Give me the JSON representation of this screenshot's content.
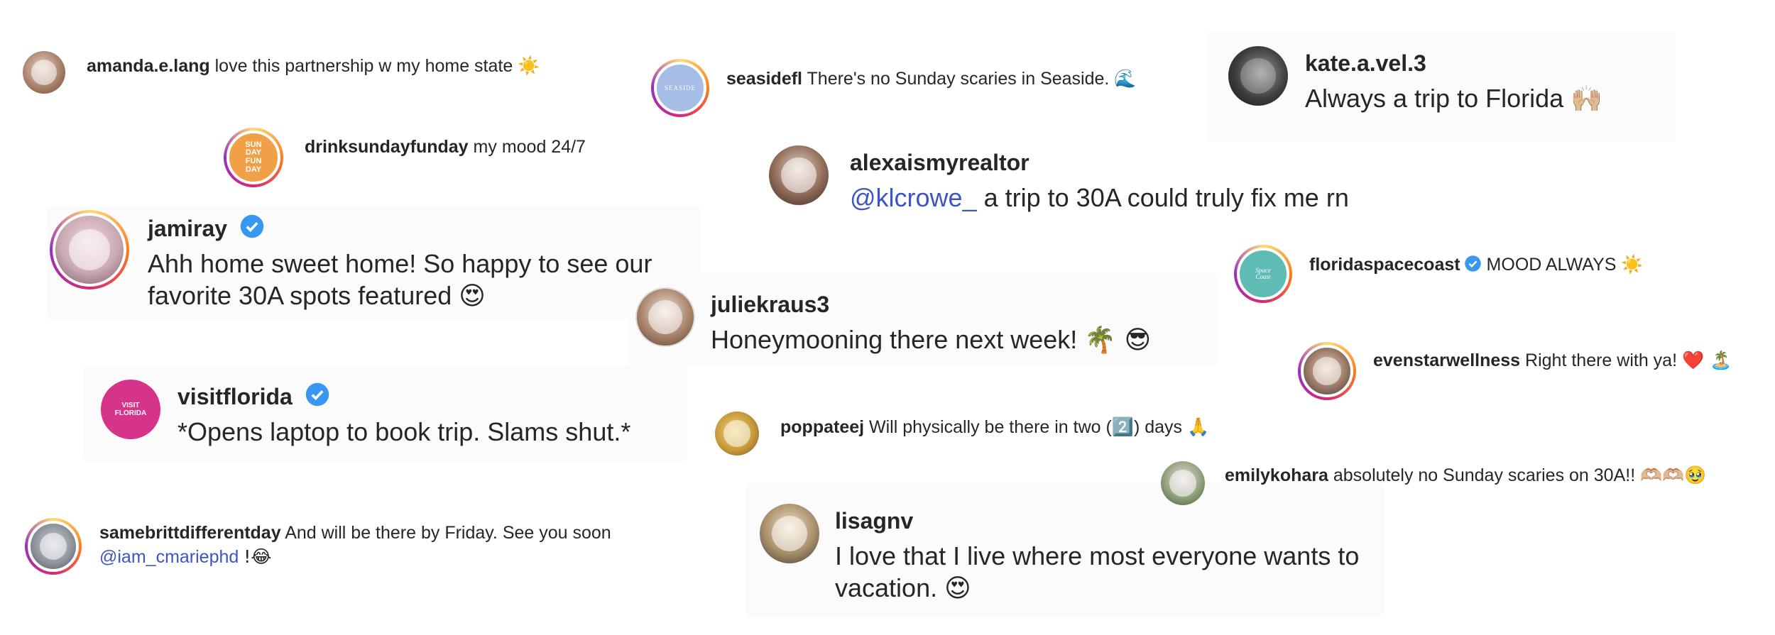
{
  "comments": [
    {
      "id": "amanda",
      "username": "amanda.e.lang",
      "text": "love this partnership w my home state",
      "emoji": "☀️"
    },
    {
      "id": "drinksunday",
      "username": "drinksundayfunday",
      "text": "my mood 24/7",
      "avatar_text": "SUN DAY FUN DAY"
    },
    {
      "id": "jamiray",
      "username": "jamiray",
      "verified": true,
      "text": "Ahh home sweet home! So happy to see our favorite 30A spots featured",
      "emoji": "😍"
    },
    {
      "id": "visitflorida",
      "username": "visitflorida",
      "verified": true,
      "text": "*Opens laptop to book trip. Slams shut.*",
      "avatar_text": "VISIT FLORIDA"
    },
    {
      "id": "samebritt",
      "username": "samebrittdifferentday",
      "text": "And will be there by Friday. See you soon",
      "mention": "@iam_cmariephd",
      "suffix": "!😂"
    },
    {
      "id": "seasidefl",
      "username": "seasidefl",
      "text": "There's no Sunday scaries in Seaside.",
      "emoji": "🌊",
      "avatar_text": "SEASIDE"
    },
    {
      "id": "alexa",
      "username": "alexaismyrealtor",
      "mention": "@klcrowe_",
      "text": "a trip to 30A could truly fix me rn"
    },
    {
      "id": "juliek",
      "username": "juliekraus3",
      "text": "Honeymooning there next week!",
      "emoji": "🌴 😎"
    },
    {
      "id": "poppateej",
      "username": "poppateej",
      "text": "Will physically be there in two (2️⃣) days",
      "emoji": "🙏"
    },
    {
      "id": "lisagnv",
      "username": "lisagnv",
      "text": "I love that I live where most everyone wants to vacation.",
      "emoji": "😍"
    },
    {
      "id": "kate",
      "username": "kate.a.vel.3",
      "text": "Always a trip to Florida",
      "emoji": "🙌🏼"
    },
    {
      "id": "spacecoast",
      "username": "floridaspacecoast",
      "verified": true,
      "text": "MOOD ALWAYS",
      "emoji": "☀️",
      "avatar_text": "Space Coast"
    },
    {
      "id": "evenstar",
      "username": "evenstarwellness",
      "text": "Right there with ya!",
      "emoji": "❤️ 🏝️"
    },
    {
      "id": "emilyk",
      "username": "emilykohara",
      "text": "absolutely no Sunday scaries on 30A!!",
      "emoji": "🫶🏼🫶🏼🥹"
    }
  ],
  "colors": {
    "text": "#262626",
    "mention": "#3b55c9",
    "verified": "#3897f0",
    "card": "#fbfbfb"
  }
}
